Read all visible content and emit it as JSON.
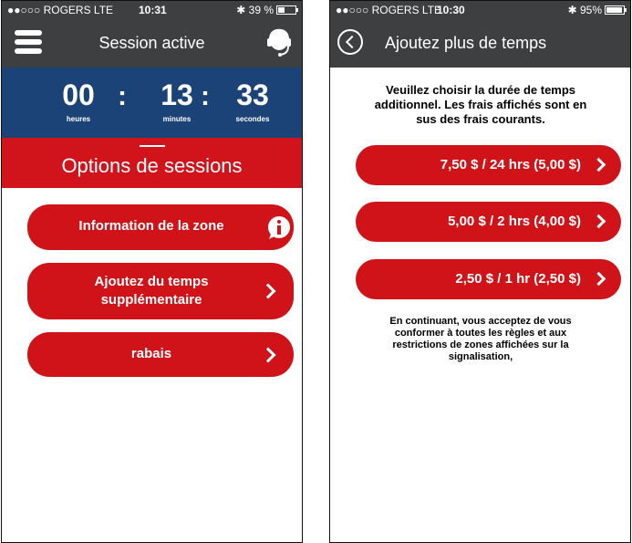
{
  "left": {
    "status_bar": {
      "carrier": "●●○○○ ROGERS  LTE",
      "time": "10:31",
      "battery": "✱ 39 %",
      "battery_level": 0.39
    },
    "nav": {
      "title": "Session active",
      "menu_icon": "hamburger-menu-icon",
      "right_icon": "headset-support-icon"
    },
    "timer": {
      "hours": "00",
      "hours_label": "heures",
      "minutes": "13",
      "minutes_label": "minutes",
      "seconds": "33",
      "seconds_label": "secondes",
      "separator": ":"
    },
    "options_title": "Options de sessions",
    "buttons": [
      {
        "label": "Information de la zone",
        "icon": "info-icon"
      },
      {
        "label_line1": "Ajoutez du temps",
        "label_line2": "supplémentaire",
        "icon": "chevron-right-icon"
      },
      {
        "label": "rabais",
        "icon": "chevron-right-icon"
      }
    ]
  },
  "right": {
    "status_bar": {
      "carrier": "●●○○○ ROGERS  LTE",
      "time": "10:30",
      "battery": "✱ 95%",
      "battery_level": 0.95
    },
    "nav": {
      "title": "Ajoutez plus de temps",
      "back_icon": "back-circle-icon"
    },
    "intro_lines": [
      "Veuillez choisir la durée de temps",
      "additionnel. Les frais affichés sont en",
      "sus des frais courants."
    ],
    "options": [
      {
        "label": "7,50 $ / 24 hrs (5,00 $)"
      },
      {
        "label": "5,00 $ / 2 hrs (4,00 $)"
      },
      {
        "label": "2,50 $ / 1 hr (2,50 $)"
      }
    ],
    "terms_lines": [
      "En continuant, vous acceptez de vous",
      "conformer à toutes les règles et aux",
      "restrictions de zones affichées sur la",
      "signalisation,"
    ]
  },
  "colors": {
    "nav": "#3d3f41",
    "timer": "#1c4377",
    "accent": "#d1141b"
  }
}
